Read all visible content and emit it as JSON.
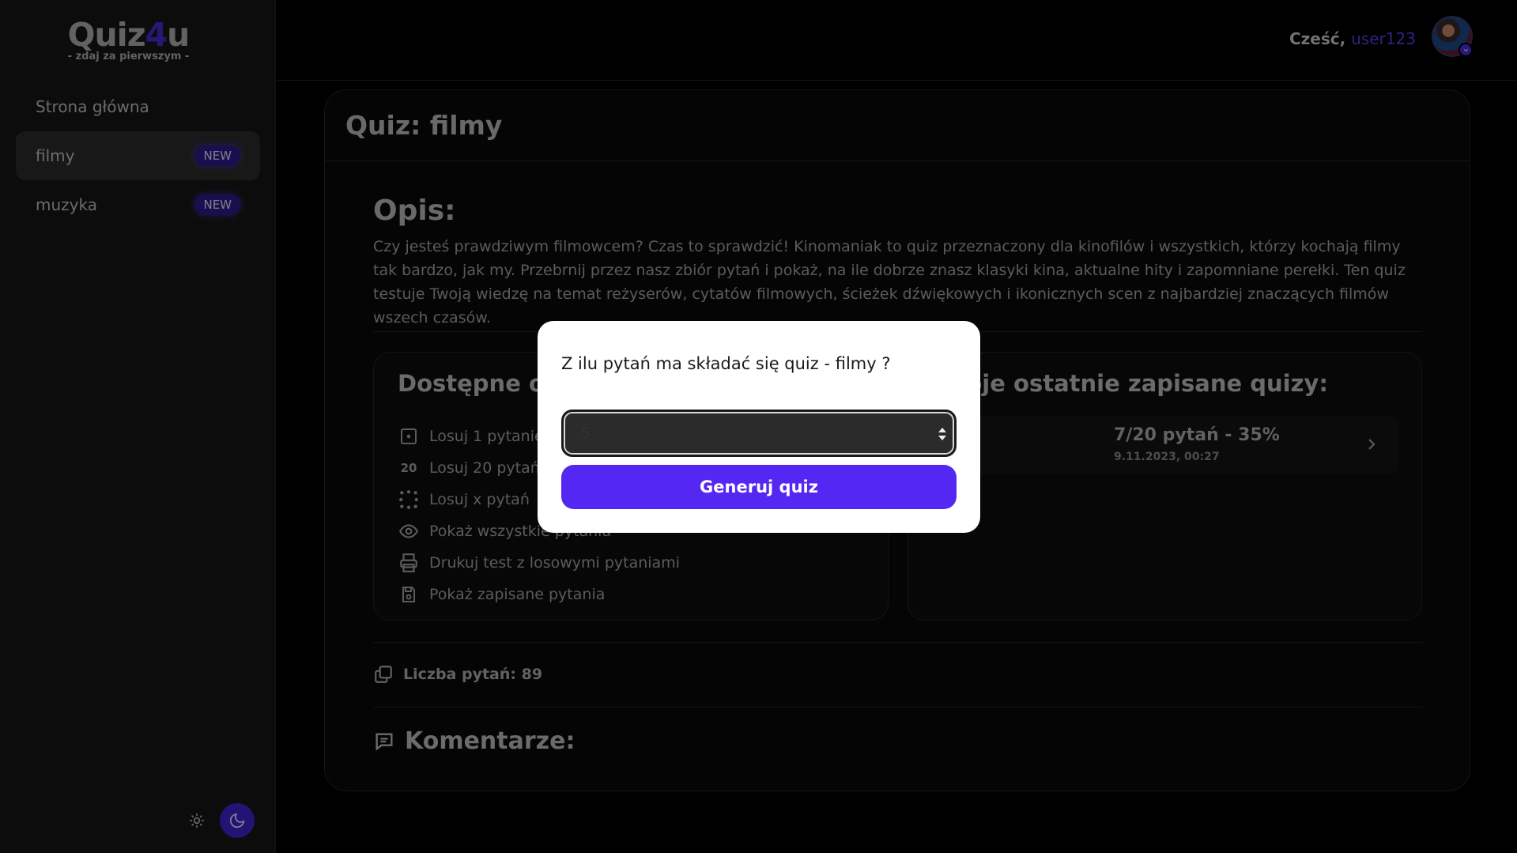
{
  "logo": {
    "title_a": "Quiz",
    "title_b": "4",
    "title_c": "u",
    "subtitle": "- zdaj za pierwszym -"
  },
  "sidebar": {
    "items": [
      {
        "label": "Strona główna",
        "badge": ""
      },
      {
        "label": "filmy",
        "badge": "NEW"
      },
      {
        "label": "muzyka",
        "badge": "NEW"
      }
    ]
  },
  "header": {
    "greeting": "Cześć,",
    "username": "user123"
  },
  "quiz": {
    "title": "Quiz: filmy",
    "description_title": "Opis:",
    "description": "Czy jesteś prawdziwym filmowcem? Czas to sprawdzić! Kinomaniak to quiz przeznaczony dla kinofilów i wszystkich, którzy kochają filmy tak bardzo, jak my. Przebrnij przez nasz zbiór pytań i pokaż, na ile dobrze znasz klasyki kina, aktualne hity i zapomniane perełki. Ten quiz testuje Twoją wiedzę na temat reżyserów, cytatów filmowych, ścieżek dźwiękowych i ikonicznych scen z najbardziej znaczących filmów wszech czasów.",
    "options_title": "Dostępne opcje:",
    "options": [
      {
        "icon": "dice-one-icon",
        "label": "Losuj 1 pytanie"
      },
      {
        "icon": "twenty-icon",
        "label": "Losuj 20 pytań"
      },
      {
        "icon": "dots-icon",
        "label": "Losuj x pytań"
      },
      {
        "icon": "eye-icon",
        "label": "Pokaż wszystkie pytania"
      },
      {
        "icon": "printer-icon",
        "label": "Drukuj test z losowymi pytaniami"
      },
      {
        "icon": "save-icon",
        "label": "Pokaż zapisane pytania"
      }
    ],
    "saved_title": "Twoje ostatnie zapisane quizy:",
    "saved": [
      {
        "score": "7/20 pytań - 35%",
        "date": "9.11.2023, 00:27"
      }
    ],
    "count_label": "Liczba pytań: 89",
    "comments_title": "Komentarze:"
  },
  "modal": {
    "question": "Z ilu pytań ma składać się quiz - filmy ?",
    "input_value": "5",
    "button": "Generuj quiz"
  },
  "colors": {
    "accent": "#5427f2",
    "badge": "#2f1d8f",
    "background": "#000000"
  }
}
